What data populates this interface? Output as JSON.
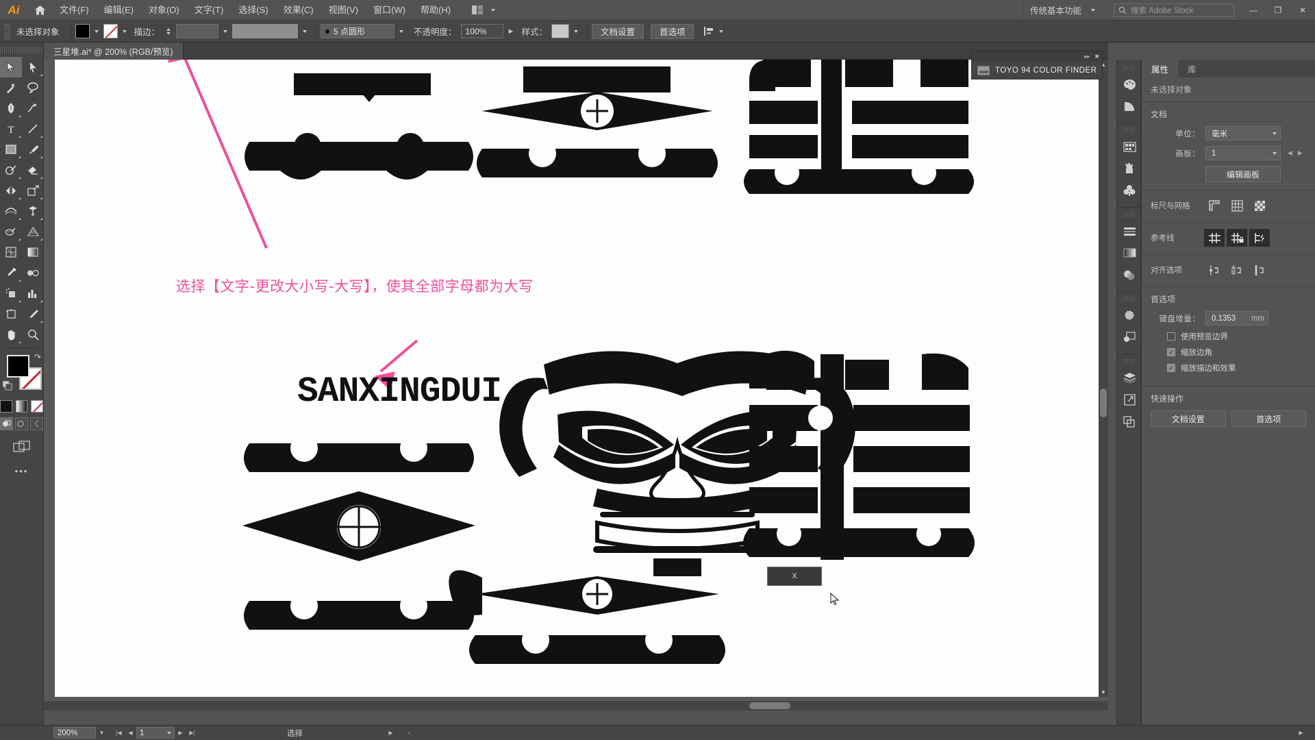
{
  "app": {
    "name": "Adobe Illustrator",
    "logo_text": "Ai"
  },
  "menubar": {
    "home_icon": "home-icon",
    "items": [
      {
        "label": "文件(F)"
      },
      {
        "label": "编辑(E)"
      },
      {
        "label": "对象(O)"
      },
      {
        "label": "文字(T)"
      },
      {
        "label": "选择(S)"
      },
      {
        "label": "效果(C)"
      },
      {
        "label": "视图(V)"
      },
      {
        "label": "窗口(W)"
      },
      {
        "label": "帮助(H)"
      }
    ],
    "arrange_icon": "arrange-documents-icon",
    "workspace": "传统基本功能",
    "search_placeholder": "搜索 Adobe Stock",
    "window_controls": {
      "minimize": "—",
      "maximize": "❐",
      "close": "✕"
    }
  },
  "optionsbar": {
    "selection_status": "未选择对象",
    "fill_label": "fill-swatch",
    "stroke_label": "描边：",
    "stroke_weight": "",
    "stroke_profile": "",
    "brush_def": "5 点圆形",
    "opacity_label": "不透明度：",
    "opacity_value": "100%",
    "style_label": "样式：",
    "doc_setup": "文档设置",
    "preferences": "首选项",
    "align_icon": "align-to-icon"
  },
  "toolbar": {
    "tools": [
      {
        "name": "selection-tool",
        "selected": true
      },
      {
        "name": "direct-selection-tool",
        "selected": false
      },
      {
        "name": "magic-wand-tool",
        "selected": false
      },
      {
        "name": "lasso-tool",
        "selected": false
      },
      {
        "name": "pen-tool",
        "selected": false
      },
      {
        "name": "curvature-tool",
        "selected": false
      },
      {
        "name": "type-tool",
        "selected": false
      },
      {
        "name": "line-segment-tool",
        "selected": false
      },
      {
        "name": "rectangle-tool",
        "selected": false
      },
      {
        "name": "paintbrush-tool",
        "selected": false
      },
      {
        "name": "shaper-tool",
        "selected": false
      },
      {
        "name": "eraser-tool",
        "selected": false
      },
      {
        "name": "rotate-tool",
        "selected": false
      },
      {
        "name": "scale-tool",
        "selected": false
      },
      {
        "name": "width-tool",
        "selected": false
      },
      {
        "name": "free-transform-tool",
        "selected": false
      },
      {
        "name": "shape-builder-tool",
        "selected": false
      },
      {
        "name": "perspective-grid-tool",
        "selected": false
      },
      {
        "name": "mesh-tool",
        "selected": false
      },
      {
        "name": "gradient-tool",
        "selected": false
      },
      {
        "name": "eyedropper-tool",
        "selected": false
      },
      {
        "name": "blend-tool",
        "selected": false
      },
      {
        "name": "symbol-sprayer-tool",
        "selected": false
      },
      {
        "name": "column-graph-tool",
        "selected": false
      },
      {
        "name": "artboard-tool",
        "selected": false
      },
      {
        "name": "slice-tool",
        "selected": false
      },
      {
        "name": "hand-tool",
        "selected": false
      },
      {
        "name": "zoom-tool",
        "selected": false
      }
    ],
    "fill_color": "#000000",
    "stroke_color": "none",
    "swap_icon": "swap-fill-stroke-icon",
    "default_icon": "default-fill-stroke-icon",
    "mini_swatches": [
      "color-swatch",
      "gradient-swatch",
      "none-swatch"
    ],
    "draw_modes": [
      "draw-normal",
      "draw-behind",
      "draw-inside"
    ],
    "screen_mode_icon": "change-screen-mode-icon",
    "more_tools": "•••"
  },
  "document_tab": {
    "title": "三星堆.ai* @ 200% (RGB/预览)"
  },
  "toyo_panel": {
    "title": "TOYO 94 COLOR FINDER",
    "collapse_icon": "collapse-panel-icon",
    "close_icon": "close-panel-icon",
    "folder_icon": "swatch-library-icon"
  },
  "canvas": {
    "annotation": "选择【文字-更改大小写-大写】，使其全部字母都为大写",
    "annotation_color": "#f0509a",
    "logo_text": "SANXINGDUI",
    "tooltip_value": "X",
    "arrows": [
      "arrow-to-type-menu",
      "arrow-to-logo-text"
    ]
  },
  "dock_icons": [
    {
      "name": "color-panel-icon"
    },
    {
      "name": "color-guide-panel-icon"
    },
    {
      "name": "swatches-panel-icon"
    },
    {
      "name": "brushes-panel-icon"
    },
    {
      "name": "symbols-panel-icon"
    },
    {
      "name": "align-panel-icon"
    },
    {
      "name": "gradient-panel-icon"
    },
    {
      "name": "transparency-panel-icon"
    },
    {
      "name": "appearance-panel-icon"
    },
    {
      "name": "graphic-styles-panel-icon"
    },
    {
      "name": "layers-panel-icon"
    },
    {
      "name": "transform-panel-icon"
    },
    {
      "name": "pathfinder-panel-icon"
    }
  ],
  "properties": {
    "tabs": [
      {
        "label": "属性",
        "active": true
      },
      {
        "label": "库",
        "active": false
      }
    ],
    "selection_status": "未选择对象",
    "document": {
      "title": "文档",
      "units_label": "单位：",
      "units_value": "毫米",
      "artboard_label": "画板：",
      "artboard_value": "1",
      "edit_artboards": "编辑画板"
    },
    "rulers_grids": {
      "label": "标尺与网格",
      "icons": [
        "show-rulers-icon",
        "show-grid-icon",
        "show-transparency-grid-icon"
      ]
    },
    "guides": {
      "label": "参考线",
      "icons": [
        "show-guides-icon",
        "lock-guides-icon",
        "smart-guides-icon"
      ]
    },
    "align_options": {
      "label": "对齐选项",
      "icons": [
        "align-to-pixel-grid-icon",
        "snap-to-grid-icon",
        "snap-to-point-icon"
      ]
    },
    "preferences": {
      "title": "首选项",
      "keyboard_increment_label": "键盘增量：",
      "keyboard_increment_value": "0.1353",
      "keyboard_increment_unit": "mm",
      "checkboxes": [
        {
          "label": "使用预览边界",
          "checked": false
        },
        {
          "label": "缩放边角",
          "checked": true
        },
        {
          "label": "缩放描边和效果",
          "checked": true
        }
      ]
    },
    "quick_actions": {
      "title": "快速操作",
      "buttons": [
        "文档设置",
        "首选项"
      ]
    }
  },
  "statusbar": {
    "zoom_value": "200%",
    "page_value": "1",
    "current_tool": "选择",
    "nav_first": "|◀",
    "nav_prev": "◀",
    "nav_next": "▶",
    "nav_last": "▶|"
  },
  "colors": {
    "chrome_bg": "#535353",
    "panel_bg": "#454545",
    "canvas_bg": "#585858",
    "artboard": "#fdfdfd",
    "accent_pink": "#f0509a",
    "ai_orange": "#ff9a00",
    "art_black": "#111111"
  }
}
